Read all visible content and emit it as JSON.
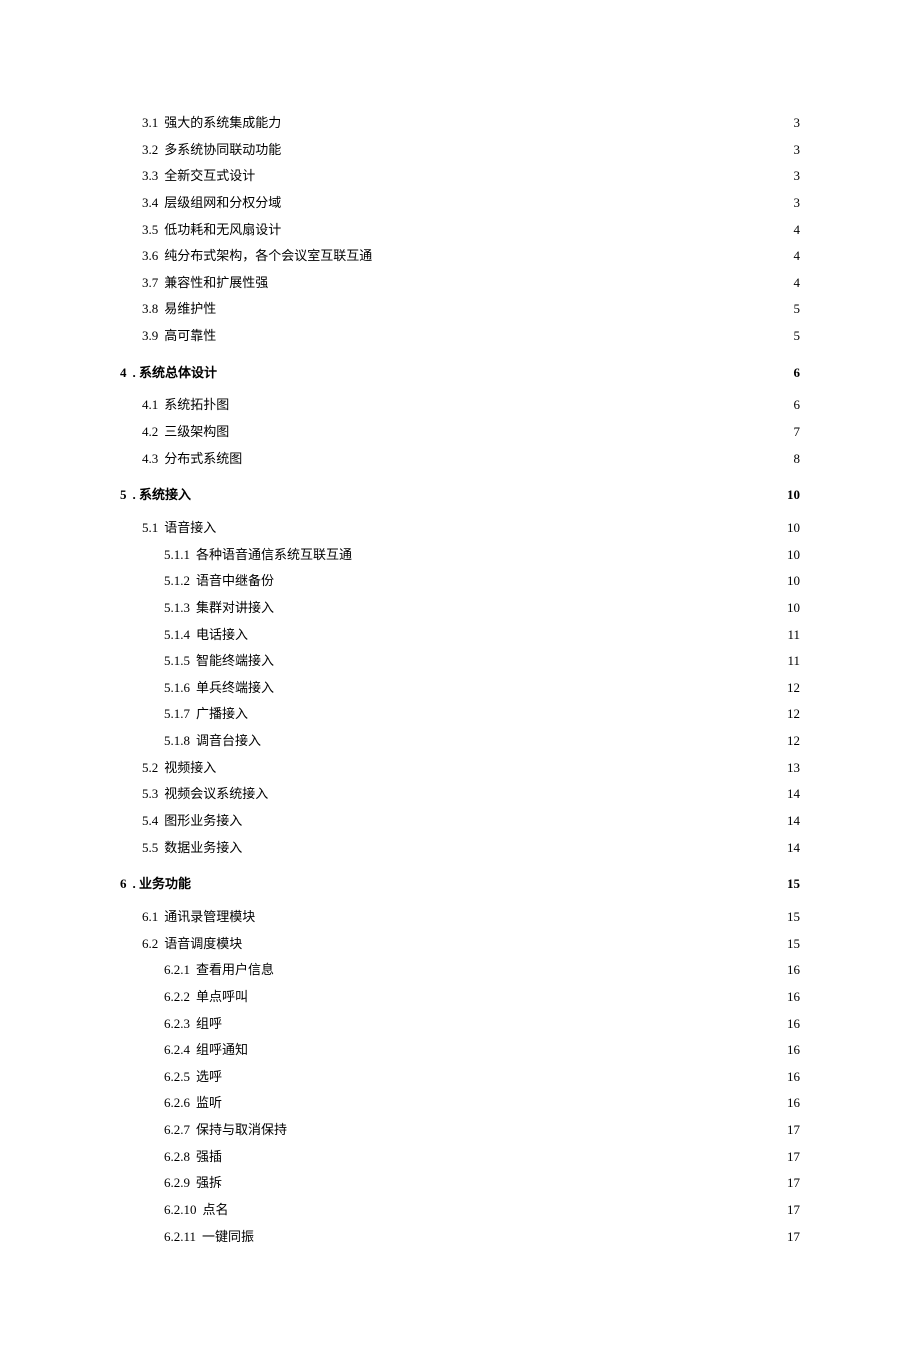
{
  "toc": [
    {
      "level": 2,
      "num": "3.1",
      "title": "强大的系统集成能力",
      "page": "3"
    },
    {
      "level": 2,
      "num": "3.2",
      "title": "多系统协同联动功能",
      "page": "3"
    },
    {
      "level": 2,
      "num": "3.3",
      "title": "全新交互式设计",
      "page": "3"
    },
    {
      "level": 2,
      "num": "3.4",
      "title": "层级组网和分权分域",
      "page": "3"
    },
    {
      "level": 2,
      "num": "3.5",
      "title": "低功耗和无风扇设计",
      "page": "4"
    },
    {
      "level": 2,
      "num": "3.6",
      "title": "纯分布式架构，各个会议室互联互通",
      "page": "4"
    },
    {
      "level": 2,
      "num": "3.7",
      "title": "兼容性和扩展性强",
      "page": "4"
    },
    {
      "level": 2,
      "num": "3.8",
      "title": "易维护性",
      "page": "5"
    },
    {
      "level": 2,
      "num": "3.9",
      "title": "高可靠性",
      "page": "5"
    },
    {
      "level": 1,
      "num": "4",
      "title": ". 系统总体设计",
      "page": "6"
    },
    {
      "level": 2,
      "num": "4.1",
      "title": "系统拓扑图",
      "page": "6"
    },
    {
      "level": 2,
      "num": "4.2",
      "title": "三级架构图",
      "page": "7"
    },
    {
      "level": 2,
      "num": "4.3",
      "title": "分布式系统图",
      "page": "8"
    },
    {
      "level": 1,
      "num": "5",
      "title": ". 系统接入",
      "page": "10"
    },
    {
      "level": 2,
      "num": "5.1",
      "title": "语音接入",
      "page": "10"
    },
    {
      "level": 3,
      "num": "5.1.1",
      "title": "各种语音通信系统互联互通",
      "page": "10"
    },
    {
      "level": 3,
      "num": "5.1.2",
      "title": "语音中继备份",
      "page": "10"
    },
    {
      "level": 3,
      "num": "5.1.3",
      "title": "集群对讲接入",
      "page": "10"
    },
    {
      "level": 3,
      "num": "5.1.4",
      "title": "电话接入",
      "page": "11"
    },
    {
      "level": 3,
      "num": "5.1.5",
      "title": "智能终端接入",
      "page": "11"
    },
    {
      "level": 3,
      "num": "5.1.6",
      "title": "单兵终端接入",
      "page": "12"
    },
    {
      "level": 3,
      "num": "5.1.7",
      "title": "广播接入",
      "page": "12"
    },
    {
      "level": 3,
      "num": "5.1.8",
      "title": "调音台接入",
      "page": "12"
    },
    {
      "level": 2,
      "num": "5.2",
      "title": "视频接入",
      "page": "13"
    },
    {
      "level": 2,
      "num": "5.3",
      "title": "视频会议系统接入",
      "page": "14"
    },
    {
      "level": 2,
      "num": "5.4",
      "title": "图形业务接入",
      "page": "14"
    },
    {
      "level": 2,
      "num": "5.5",
      "title": "数据业务接入",
      "page": "14"
    },
    {
      "level": 1,
      "num": "6",
      "title": ". 业务功能",
      "page": "15"
    },
    {
      "level": 2,
      "num": "6.1",
      "title": "通讯录管理模块",
      "page": "15"
    },
    {
      "level": 2,
      "num": "6.2",
      "title": "语音调度模块",
      "page": "15"
    },
    {
      "level": 3,
      "num": "6.2.1",
      "title": "查看用户信息",
      "page": "16"
    },
    {
      "level": 3,
      "num": "6.2.2",
      "title": "单点呼叫",
      "page": "16"
    },
    {
      "level": 3,
      "num": "6.2.3",
      "title": "组呼",
      "page": "16"
    },
    {
      "level": 3,
      "num": "6.2.4",
      "title": "组呼通知",
      "page": "16"
    },
    {
      "level": 3,
      "num": "6.2.5",
      "title": "选呼",
      "page": "16"
    },
    {
      "level": 3,
      "num": "6.2.6",
      "title": "监听",
      "page": "16"
    },
    {
      "level": 3,
      "num": "6.2.7",
      "title": "保持与取消保持",
      "page": "17"
    },
    {
      "level": 3,
      "num": "6.2.8",
      "title": "强插",
      "page": "17"
    },
    {
      "level": 3,
      "num": "6.2.9",
      "title": "强拆",
      "page": "17"
    },
    {
      "level": 3,
      "num": "6.2.10",
      "title": "点名",
      "page": "17"
    },
    {
      "level": 3,
      "num": "6.2.11",
      "title": "一键同振",
      "page": "17"
    }
  ]
}
